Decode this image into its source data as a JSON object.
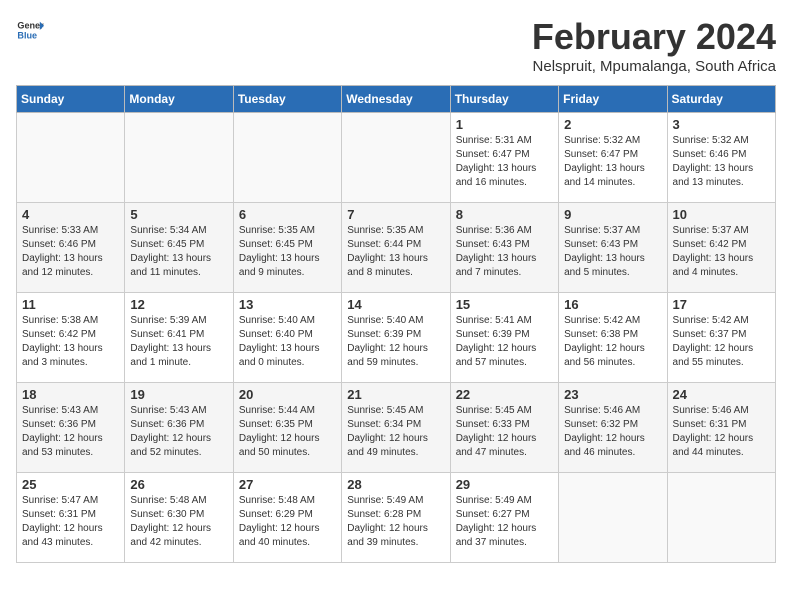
{
  "header": {
    "logo_general": "General",
    "logo_blue": "Blue",
    "month_title": "February 2024",
    "location": "Nelspruit, Mpumalanga, South Africa"
  },
  "weekdays": [
    "Sunday",
    "Monday",
    "Tuesday",
    "Wednesday",
    "Thursday",
    "Friday",
    "Saturday"
  ],
  "weeks": [
    [
      {
        "day": "",
        "detail": ""
      },
      {
        "day": "",
        "detail": ""
      },
      {
        "day": "",
        "detail": ""
      },
      {
        "day": "",
        "detail": ""
      },
      {
        "day": "1",
        "detail": "Sunrise: 5:31 AM\nSunset: 6:47 PM\nDaylight: 13 hours\nand 16 minutes."
      },
      {
        "day": "2",
        "detail": "Sunrise: 5:32 AM\nSunset: 6:47 PM\nDaylight: 13 hours\nand 14 minutes."
      },
      {
        "day": "3",
        "detail": "Sunrise: 5:32 AM\nSunset: 6:46 PM\nDaylight: 13 hours\nand 13 minutes."
      }
    ],
    [
      {
        "day": "4",
        "detail": "Sunrise: 5:33 AM\nSunset: 6:46 PM\nDaylight: 13 hours\nand 12 minutes."
      },
      {
        "day": "5",
        "detail": "Sunrise: 5:34 AM\nSunset: 6:45 PM\nDaylight: 13 hours\nand 11 minutes."
      },
      {
        "day": "6",
        "detail": "Sunrise: 5:35 AM\nSunset: 6:45 PM\nDaylight: 13 hours\nand 9 minutes."
      },
      {
        "day": "7",
        "detail": "Sunrise: 5:35 AM\nSunset: 6:44 PM\nDaylight: 13 hours\nand 8 minutes."
      },
      {
        "day": "8",
        "detail": "Sunrise: 5:36 AM\nSunset: 6:43 PM\nDaylight: 13 hours\nand 7 minutes."
      },
      {
        "day": "9",
        "detail": "Sunrise: 5:37 AM\nSunset: 6:43 PM\nDaylight: 13 hours\nand 5 minutes."
      },
      {
        "day": "10",
        "detail": "Sunrise: 5:37 AM\nSunset: 6:42 PM\nDaylight: 13 hours\nand 4 minutes."
      }
    ],
    [
      {
        "day": "11",
        "detail": "Sunrise: 5:38 AM\nSunset: 6:42 PM\nDaylight: 13 hours\nand 3 minutes."
      },
      {
        "day": "12",
        "detail": "Sunrise: 5:39 AM\nSunset: 6:41 PM\nDaylight: 13 hours\nand 1 minute."
      },
      {
        "day": "13",
        "detail": "Sunrise: 5:40 AM\nSunset: 6:40 PM\nDaylight: 13 hours\nand 0 minutes."
      },
      {
        "day": "14",
        "detail": "Sunrise: 5:40 AM\nSunset: 6:39 PM\nDaylight: 12 hours\nand 59 minutes."
      },
      {
        "day": "15",
        "detail": "Sunrise: 5:41 AM\nSunset: 6:39 PM\nDaylight: 12 hours\nand 57 minutes."
      },
      {
        "day": "16",
        "detail": "Sunrise: 5:42 AM\nSunset: 6:38 PM\nDaylight: 12 hours\nand 56 minutes."
      },
      {
        "day": "17",
        "detail": "Sunrise: 5:42 AM\nSunset: 6:37 PM\nDaylight: 12 hours\nand 55 minutes."
      }
    ],
    [
      {
        "day": "18",
        "detail": "Sunrise: 5:43 AM\nSunset: 6:36 PM\nDaylight: 12 hours\nand 53 minutes."
      },
      {
        "day": "19",
        "detail": "Sunrise: 5:43 AM\nSunset: 6:36 PM\nDaylight: 12 hours\nand 52 minutes."
      },
      {
        "day": "20",
        "detail": "Sunrise: 5:44 AM\nSunset: 6:35 PM\nDaylight: 12 hours\nand 50 minutes."
      },
      {
        "day": "21",
        "detail": "Sunrise: 5:45 AM\nSunset: 6:34 PM\nDaylight: 12 hours\nand 49 minutes."
      },
      {
        "day": "22",
        "detail": "Sunrise: 5:45 AM\nSunset: 6:33 PM\nDaylight: 12 hours\nand 47 minutes."
      },
      {
        "day": "23",
        "detail": "Sunrise: 5:46 AM\nSunset: 6:32 PM\nDaylight: 12 hours\nand 46 minutes."
      },
      {
        "day": "24",
        "detail": "Sunrise: 5:46 AM\nSunset: 6:31 PM\nDaylight: 12 hours\nand 44 minutes."
      }
    ],
    [
      {
        "day": "25",
        "detail": "Sunrise: 5:47 AM\nSunset: 6:31 PM\nDaylight: 12 hours\nand 43 minutes."
      },
      {
        "day": "26",
        "detail": "Sunrise: 5:48 AM\nSunset: 6:30 PM\nDaylight: 12 hours\nand 42 minutes."
      },
      {
        "day": "27",
        "detail": "Sunrise: 5:48 AM\nSunset: 6:29 PM\nDaylight: 12 hours\nand 40 minutes."
      },
      {
        "day": "28",
        "detail": "Sunrise: 5:49 AM\nSunset: 6:28 PM\nDaylight: 12 hours\nand 39 minutes."
      },
      {
        "day": "29",
        "detail": "Sunrise: 5:49 AM\nSunset: 6:27 PM\nDaylight: 12 hours\nand 37 minutes."
      },
      {
        "day": "",
        "detail": ""
      },
      {
        "day": "",
        "detail": ""
      }
    ]
  ]
}
